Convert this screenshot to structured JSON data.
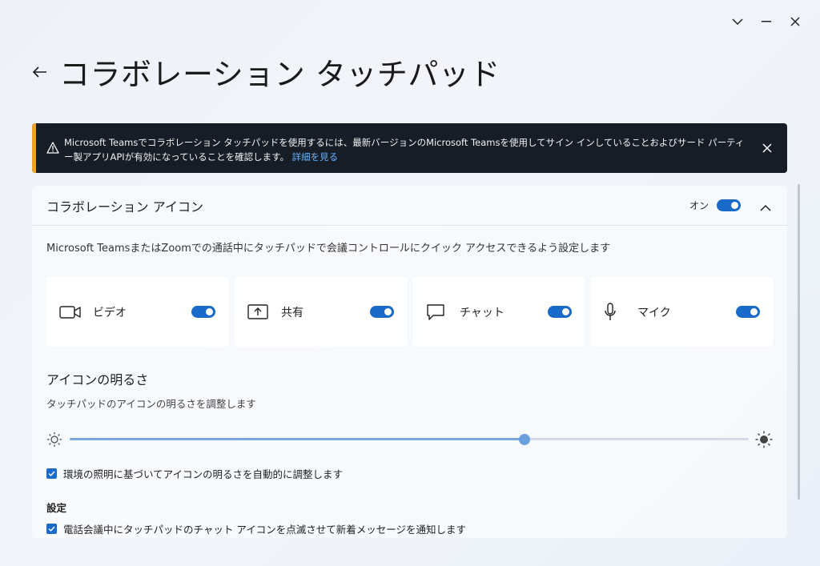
{
  "window": {
    "controls": [
      "chevron-down-icon",
      "minimize-icon",
      "close-icon"
    ]
  },
  "header": {
    "title": "コラボレーション タッチパッド"
  },
  "banner": {
    "text": "Microsoft Teamsでコラボレーション タッチパッドを使用するには、最新バージョンのMicrosoft Teamsを使用してサイン インしていることおよびサード パーティー製アプリAPIが有効になっていることを確認します。",
    "link": "詳細を見る",
    "accent_color": "#f0a030"
  },
  "collab_icons": {
    "title": "コラボレーション アイコン",
    "toggle_label": "オン",
    "toggle_on": true,
    "description": "Microsoft TeamsまたはZoomでの通話中にタッチパッドで会議コントロールにクイック アクセスできるよう設定します",
    "cards": [
      {
        "label": "ビデオ",
        "icon": "video-camera-icon",
        "on": true
      },
      {
        "label": "共有",
        "icon": "share-screen-icon",
        "on": true
      },
      {
        "label": "チャット",
        "icon": "chat-icon",
        "on": true
      },
      {
        "label": "マイク",
        "icon": "microphone-icon",
        "on": true
      }
    ]
  },
  "brightness": {
    "title": "アイコンの明るさ",
    "subtitle": "タッチパッドのアイコンの明るさを調整します",
    "value": 0.67,
    "auto_adjust_label": "環境の照明に基づいてアイコンの明るさを自動的に調整します",
    "auto_adjust_checked": true
  },
  "settings": {
    "title": "設定",
    "notify_label": "電話会議中にタッチパッドのチャット アイコンを点滅させて新着メッセージを通知します",
    "notify_checked": true
  },
  "colors": {
    "accent": "#1a6ac9",
    "banner_bg": "#161d27"
  }
}
